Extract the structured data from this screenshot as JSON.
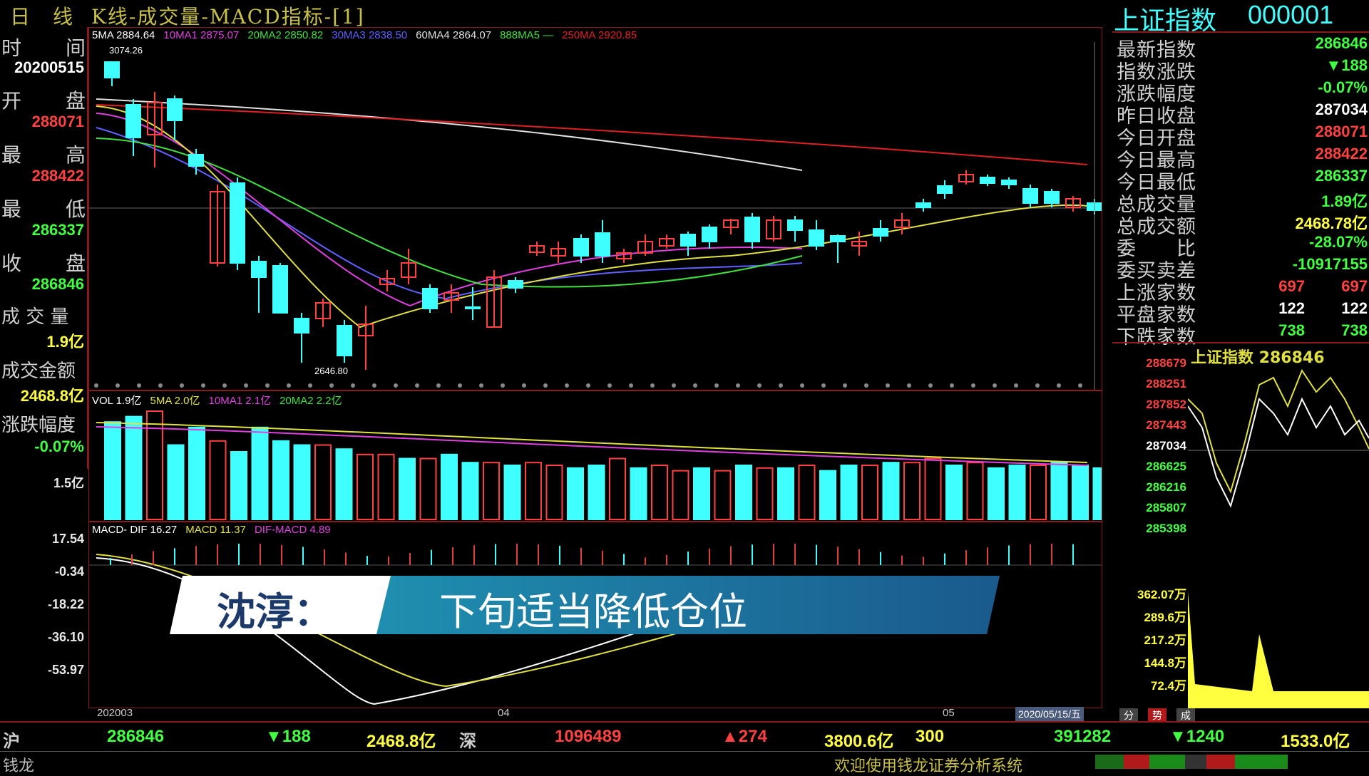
{
  "title_bar": {
    "period": "日　线",
    "indicator_title": "K线-成交量-MACD指标-[1]"
  },
  "left_panel": {
    "time_label": [
      "时",
      "间"
    ],
    "time_value": "20200515",
    "open_label": [
      "开",
      "盘"
    ],
    "open_value": "288071",
    "high_label": [
      "最",
      "高"
    ],
    "high_value": "288422",
    "low_label": [
      "最",
      "低"
    ],
    "low_value": "286337",
    "close_label": [
      "收",
      "盘"
    ],
    "close_value": "286846",
    "volume_label": "成 交 量",
    "volume_value": "1.9亿",
    "amount_label": "成交金额",
    "amount_value": "2468.8亿",
    "change_pct_label": "涨跌幅度",
    "change_pct_value": "-0.07%"
  },
  "kline": {
    "ma_legend": [
      {
        "text": "5MA 2884.64",
        "color": "#ffffff"
      },
      {
        "text": "10MA1 2875.07",
        "color": "#e040e0"
      },
      {
        "text": "20MA2 2850.82",
        "color": "#40e040"
      },
      {
        "text": "30MA3 2838.50",
        "color": "#6060ff"
      },
      {
        "text": "60MA4 2864.07",
        "color": "#e0e0e0"
      },
      {
        "text": "888MA5 —",
        "color": "#40e040"
      },
      {
        "text": "250MA 2920.85",
        "color": "#e02020"
      }
    ],
    "high_annotation": "3074.26",
    "low_annotation": "2646.80"
  },
  "volume": {
    "legend": [
      {
        "text": "VOL 1.9亿",
        "color": "#ffffff"
      },
      {
        "text": "5MA 2.0亿",
        "color": "#e0e040"
      },
      {
        "text": "10MA1 2.1亿",
        "color": "#e040e0"
      },
      {
        "text": "20MA2 2.2亿",
        "color": "#40e040"
      }
    ],
    "axis_label": "1.5亿",
    "bar_heights": [
      0.72,
      0.76,
      0.8,
      0.55,
      0.68,
      0.58,
      0.5,
      0.68,
      0.58,
      0.55,
      0.55,
      0.52,
      0.48,
      0.48,
      0.45,
      0.45,
      0.48,
      0.42,
      0.42,
      0.4,
      0.42,
      0.4,
      0.38,
      0.4,
      0.45,
      0.38,
      0.4,
      0.36,
      0.38,
      0.36,
      0.4,
      0.38,
      0.38,
      0.4,
      0.36,
      0.4,
      0.4,
      0.42,
      0.42,
      0.45,
      0.4,
      0.42,
      0.38,
      0.4,
      0.4,
      0.42,
      0.4,
      0.38
    ],
    "bar_solid": [
      true,
      true,
      false,
      true,
      true,
      false,
      true,
      true,
      true,
      true,
      false,
      true,
      false,
      false,
      true,
      false,
      true,
      true,
      false,
      true,
      false,
      false,
      true,
      true,
      false,
      true,
      false,
      false,
      true,
      false,
      true,
      false,
      true,
      false,
      true,
      true,
      false,
      true,
      false,
      false,
      true,
      false,
      true,
      true,
      false,
      true,
      true,
      true
    ]
  },
  "macd": {
    "legend": [
      {
        "text": "MACD- DIF 16.27",
        "color": "#ffffff"
      },
      {
        "text": "MACD 11.37",
        "color": "#e0e040"
      },
      {
        "text": "DIF-MACD 4.89",
        "color": "#e040e0"
      }
    ],
    "axis_labels": [
      "17.54",
      "-0.34",
      "-18.22",
      "-36.10",
      "-53.97"
    ]
  },
  "x_axis": {
    "labels": [
      "202003",
      "04",
      "05"
    ],
    "cursor_date": "2020/05/15/五"
  },
  "banner": {
    "name": "沈淳：",
    "headline": "下旬适当降低仓位"
  },
  "right_panel": {
    "index_name": "上证指数",
    "index_code": "000001",
    "rows": [
      {
        "key": "最新指数",
        "value": "286846",
        "color": "#40ff40"
      },
      {
        "key": "指数涨跌",
        "value": "▼188",
        "color": "#40ff40"
      },
      {
        "key": "涨跌幅度",
        "value": "-0.07%",
        "color": "#40ff40"
      },
      {
        "key": "昨日收盘",
        "value": "287034",
        "color": "#ffffff"
      },
      {
        "key": "今日开盘",
        "value": "288071",
        "color": "#ff4040"
      },
      {
        "key": "今日最高",
        "value": "288422",
        "color": "#ff4040"
      },
      {
        "key": "今日最低",
        "value": "286337",
        "color": "#40ff40"
      },
      {
        "key": "总成交量",
        "value": "1.89亿",
        "color": "#40ff40"
      },
      {
        "key": "总成交额",
        "value": "2468.78亿",
        "color": "#ffff40"
      },
      {
        "key": "委　　比",
        "value": "-28.07%",
        "color": "#40ff40"
      },
      {
        "key": "委买卖差",
        "value": "-10917155",
        "color": "#40ff40"
      },
      {
        "key": "上涨家数",
        "value": "697",
        "value2": "697",
        "color": "#ff4040"
      },
      {
        "key": "平盘家数",
        "value": "122",
        "value2": "122",
        "color": "#ffffff"
      },
      {
        "key": "下跌家数",
        "value": "738",
        "value2": "738",
        "color": "#40ff40"
      }
    ],
    "mini_chart": {
      "title": "上证指数 286846",
      "price_labels": [
        {
          "text": "288679",
          "color": "#ff4040"
        },
        {
          "text": "288251",
          "color": "#ff4040"
        },
        {
          "text": "287852",
          "color": "#ff4040"
        },
        {
          "text": "287443",
          "color": "#ff4040"
        },
        {
          "text": "287034",
          "color": "#ffffff"
        },
        {
          "text": "286625",
          "color": "#40ff40"
        },
        {
          "text": "286216",
          "color": "#40ff40"
        },
        {
          "text": "285807",
          "color": "#40ff40"
        },
        {
          "text": "285398",
          "color": "#40ff40"
        }
      ],
      "volume_labels": [
        "362.07万",
        "289.6万",
        "217.2万",
        "144.8万",
        "72.4万"
      ],
      "tabs": [
        "分",
        "势",
        "成"
      ]
    }
  },
  "bottom_bar": {
    "sh_label": "沪",
    "sh_index": "286846",
    "sh_change": "▼188",
    "sh_amount": "2468.8亿",
    "sz_label": "深",
    "sz_index": "1096489",
    "sz_change": "▲274",
    "sz_amount": "3800.6亿",
    "c300_label": "300",
    "c300_index": "391282",
    "c300_change": "▼1240",
    "c300_amount": "1533.0亿",
    "app_name": "钱龙",
    "welcome": "欢迎使用钱龙证券分析系统"
  },
  "colors": {
    "up": "#ff4040",
    "down": "#40ffff",
    "frame": "#8a1a1a",
    "accent_yellow": "#e0e040"
  }
}
